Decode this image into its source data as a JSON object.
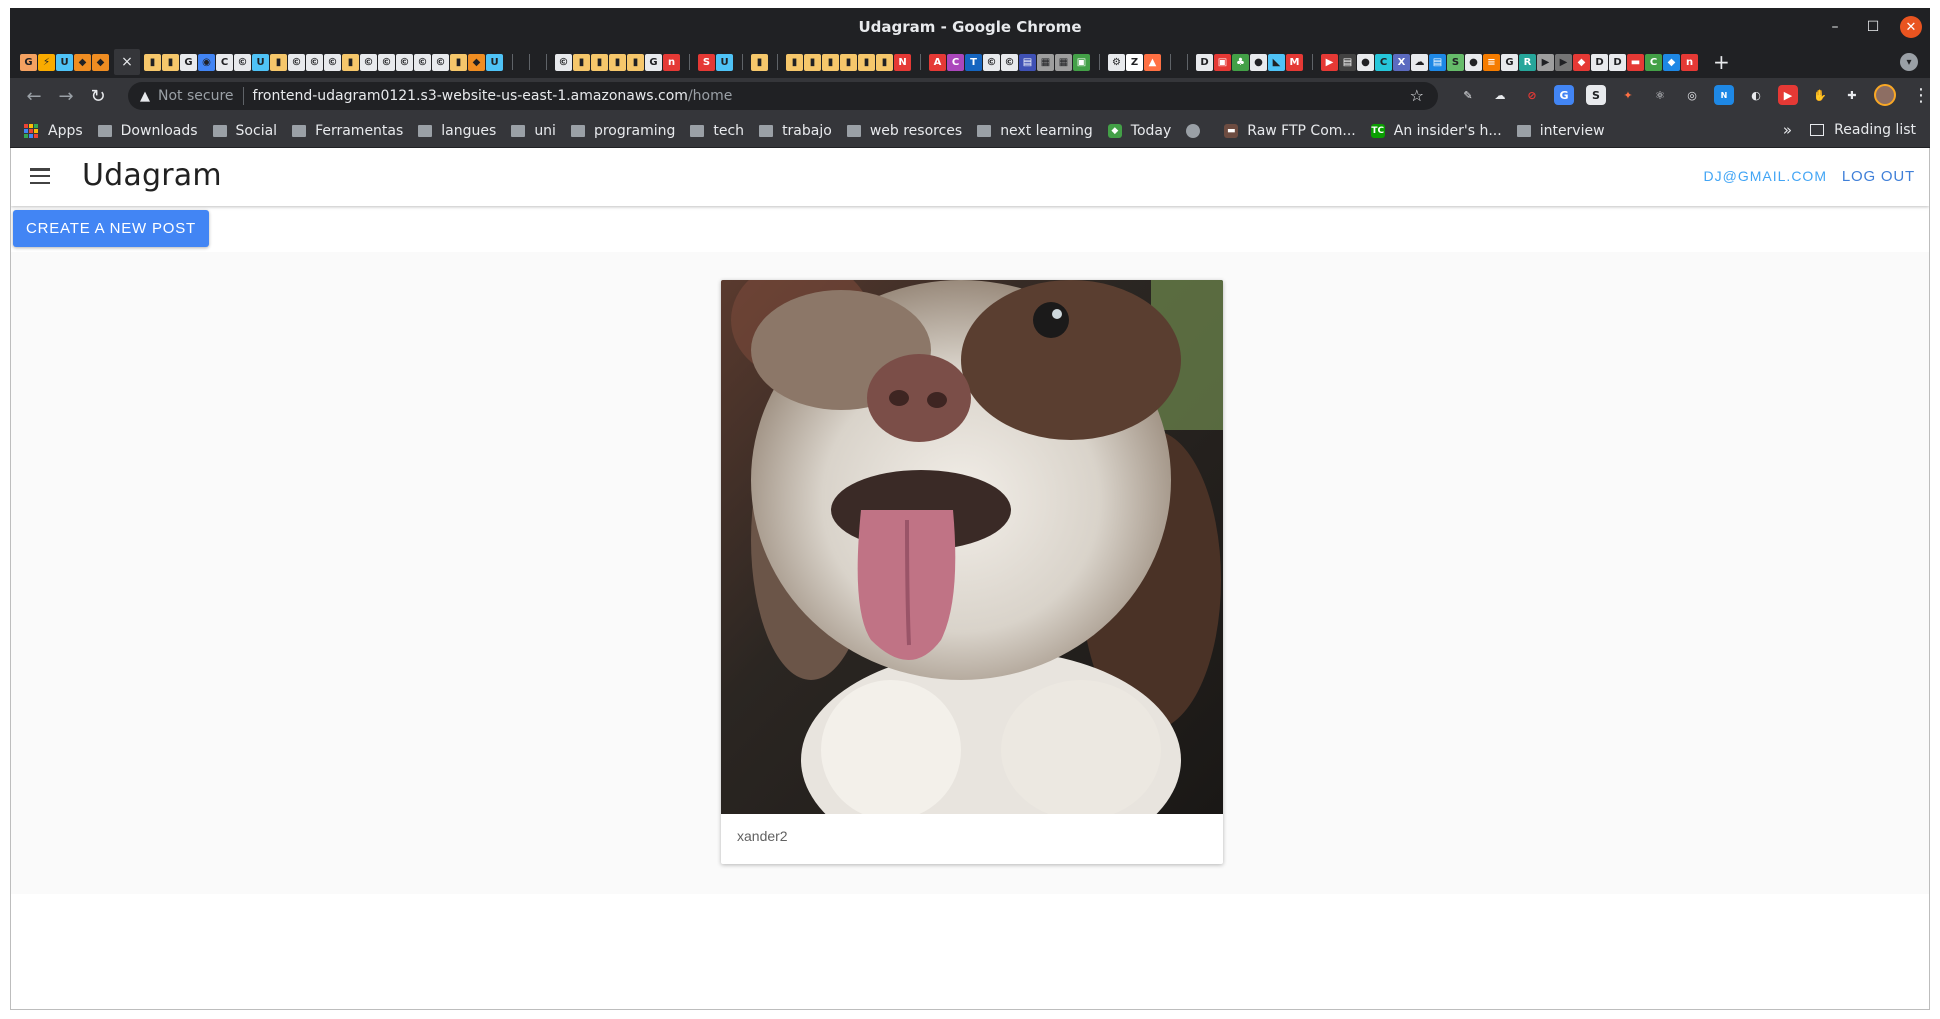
{
  "window": {
    "title": "Udagram - Google Chrome"
  },
  "tabs": {
    "active_close_glyph": "×",
    "new_tab_glyph": "+"
  },
  "omnibox": {
    "security_label": "Not secure",
    "host": "frontend-udagram0121.s3-website-us-east-1.amazonaws.com",
    "path": "/home"
  },
  "bookmarks": {
    "items": [
      {
        "label": "Apps",
        "icon": "apps-grid-icon"
      },
      {
        "label": "Downloads",
        "icon": "folder-icon"
      },
      {
        "label": "Social",
        "icon": "folder-icon"
      },
      {
        "label": "Ferramentas",
        "icon": "folder-icon"
      },
      {
        "label": "langues",
        "icon": "folder-icon"
      },
      {
        "label": "uni",
        "icon": "folder-icon"
      },
      {
        "label": "programing",
        "icon": "folder-icon"
      },
      {
        "label": "tech",
        "icon": "folder-icon"
      },
      {
        "label": "trabajo",
        "icon": "folder-icon"
      },
      {
        "label": "web resorces",
        "icon": "folder-icon"
      },
      {
        "label": "next learning",
        "icon": "folder-icon"
      },
      {
        "label": "Today",
        "icon": "today-icon"
      },
      {
        "label": "",
        "icon": "globe-icon"
      },
      {
        "label": "Raw FTP Com...",
        "icon": "ftp-icon"
      },
      {
        "label": "An insider's h...",
        "icon": "techcrunch-icon"
      },
      {
        "label": "interview",
        "icon": "folder-icon"
      }
    ],
    "overflow": "»",
    "reading_list": "Reading list"
  },
  "app": {
    "brand": "Udagram",
    "user_email": "DJ@GMAIL.COM",
    "logout_label": "LOG OUT",
    "create_post_label": "CREATE A NEW POST"
  },
  "feed": {
    "posts": [
      {
        "caption": "xander2",
        "image": "photo of a brown and white fluffy dog with its tongue out"
      }
    ]
  },
  "colors": {
    "primary_button": "#4285f4",
    "email_link": "#42a5f5",
    "logout_link": "#3f7fd8",
    "chrome_dark": "#202124",
    "chrome_toolbar": "#35363a"
  }
}
